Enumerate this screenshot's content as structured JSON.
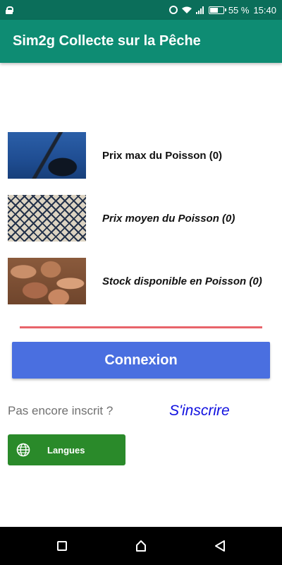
{
  "status_bar": {
    "battery": "55 %",
    "battery_level": 0.55,
    "time": "15:40",
    "icons": [
      "lock-icon",
      "alarm-icon",
      "wifi-icon",
      "signal-icon",
      "battery-icon"
    ]
  },
  "app_bar": {
    "title": "Sim2g Collecte sur la Pêche",
    "color": "#0e8c73"
  },
  "menu": [
    {
      "label": "Prix max du Poisson (0)",
      "image": "swordfish-photo",
      "italic": false
    },
    {
      "label": "Prix moyen du Poisson (0)",
      "image": "fishing-net-photo",
      "italic": true
    },
    {
      "label": "Stock disponible en Poisson (0)",
      "image": "fish-stock-photo",
      "italic": true
    }
  ],
  "login": {
    "connect_label": "Connexion",
    "connect_color": "#4a6fe0",
    "divider_color": "#e8646a"
  },
  "signup": {
    "prompt": "Pas encore inscrit ?",
    "link_label": "S'inscrire",
    "link_color": "#1010e0"
  },
  "language": {
    "label": "Langues",
    "icon": "globe-icon",
    "color": "#2a8a2a"
  },
  "nav_bar": {
    "icons": [
      "recent-apps-icon",
      "home-icon",
      "back-icon"
    ]
  }
}
